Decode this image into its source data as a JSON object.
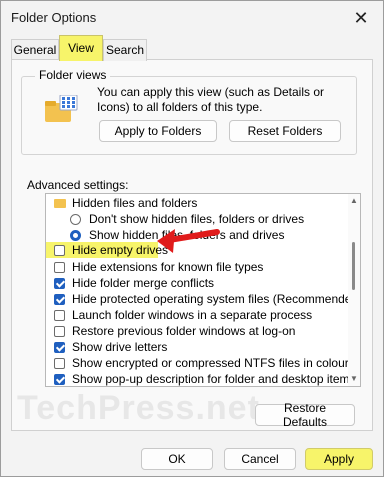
{
  "window": {
    "title": "Folder Options",
    "close_glyph": "✕"
  },
  "tabs": [
    {
      "label": "General",
      "selected": false
    },
    {
      "label": "View",
      "selected": true
    },
    {
      "label": "Search",
      "selected": false
    }
  ],
  "folder_views": {
    "group_label": "Folder views",
    "description": "You can apply this view (such as Details or Icons) to all folders of this type.",
    "apply_button": "Apply to Folders",
    "reset_button": "Reset Folders"
  },
  "advanced": {
    "label": "Advanced settings:",
    "items": [
      {
        "type": "folder",
        "label": "Hidden files and folders"
      },
      {
        "type": "radio",
        "checked": false,
        "label": "Don't show hidden files, folders or drives"
      },
      {
        "type": "radio",
        "checked": true,
        "label": "Show hidden files, folders and drives"
      },
      {
        "type": "checkbox",
        "checked": false,
        "label": "Hide empty drives",
        "highlighted": true
      },
      {
        "type": "checkbox",
        "checked": false,
        "label": "Hide extensions for known file types"
      },
      {
        "type": "checkbox",
        "checked": true,
        "label": "Hide folder merge conflicts"
      },
      {
        "type": "checkbox",
        "checked": true,
        "label": "Hide protected operating system files (Recommended)"
      },
      {
        "type": "checkbox",
        "checked": false,
        "label": "Launch folder windows in a separate process"
      },
      {
        "type": "checkbox",
        "checked": false,
        "label": "Restore previous folder windows at log-on"
      },
      {
        "type": "checkbox",
        "checked": true,
        "label": "Show drive letters"
      },
      {
        "type": "checkbox",
        "checked": false,
        "label": "Show encrypted or compressed NTFS files in colour"
      },
      {
        "type": "checkbox",
        "checked": true,
        "label": "Show pop-up description for folder and desktop items"
      }
    ]
  },
  "restore_defaults": "Restore Defaults",
  "footer": {
    "ok": "OK",
    "cancel": "Cancel",
    "apply": "Apply"
  },
  "watermark": "TechPress.net",
  "colors": {
    "highlight": "#f7f46a",
    "accent": "#1f5fbf",
    "arrow": "#e01b1b",
    "folder": "#f3c24f"
  }
}
